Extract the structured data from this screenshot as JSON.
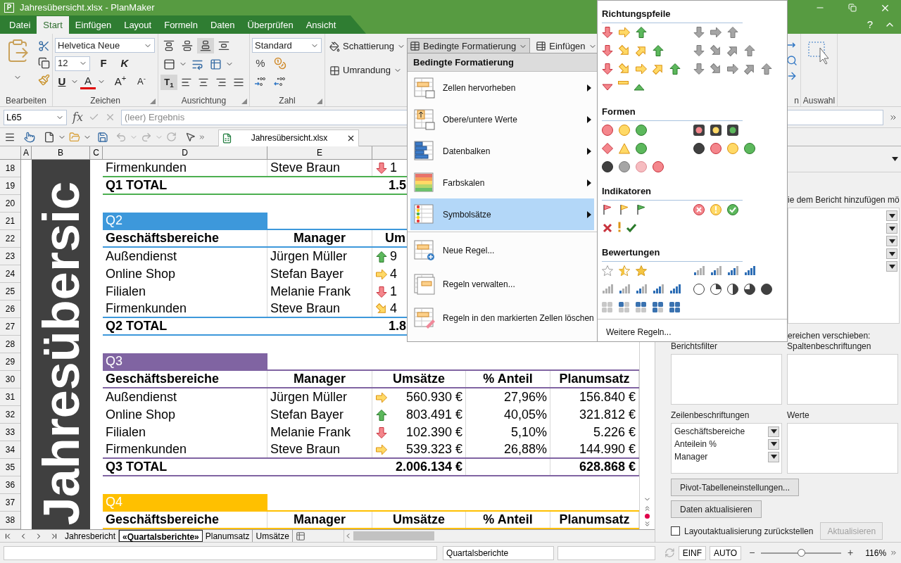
{
  "window": {
    "icon_letter": "P",
    "title": "Jahresübersicht.xlsx - PlanMaker",
    "help": "?"
  },
  "menu_tabs": [
    {
      "label": "Datei",
      "selected": false
    },
    {
      "label": "Start",
      "selected": true
    },
    {
      "label": "Einfügen",
      "selected": false
    },
    {
      "label": "Layout",
      "selected": false
    },
    {
      "label": "Formeln",
      "selected": false
    },
    {
      "label": "Daten",
      "selected": false
    },
    {
      "label": "Überprüfen",
      "selected": false
    },
    {
      "label": "Ansicht",
      "selected": false
    }
  ],
  "ribbon": {
    "font": "Helvetica Neue",
    "size": "12",
    "bold": "F",
    "italic": "K",
    "underline": "U",
    "font_color": "A",
    "grow": "A$^{+}$",
    "shrink": "A$^{-}$",
    "valign": [
      {
        "selected": false
      },
      {
        "selected": false
      },
      {
        "selected": true
      },
      {
        "selected": false
      }
    ],
    "rotate_text": {
      "label": "T$_{1}$",
      "selected": true
    },
    "number_format": "Standard",
    "percent": "%",
    "format_buttons": [
      {
        "label": "Schattierung",
        "open": false
      },
      {
        "label": "Umrandung",
        "open": false
      },
      {
        "label": "Bedingte Formatierung",
        "open": true
      },
      {
        "label": "Einfügen",
        "open": false
      }
    ],
    "groups": [
      {
        "label": "Bearbeiten",
        "launcher": false
      },
      {
        "label": "Zeichen",
        "launcher": true
      },
      {
        "label": "Ausrichtung",
        "launcher": true
      },
      {
        "label": "Zahl",
        "launcher": true
      },
      {
        "label": "n"
      },
      {
        "label": "Auswahl",
        "launcher": false
      }
    ]
  },
  "formula_bar": {
    "cell_ref": "L65",
    "function": "fx",
    "placeholder": "(leer) Ergebnis"
  },
  "toolbar": {
    "document_tab": "Jahresübersicht.xlsx"
  },
  "sheet": {
    "columns": [
      "A",
      "B",
      "C",
      "D",
      "E"
    ],
    "vertical_title": "Jahresübersic",
    "sections": [
      {
        "color": "#4caf50",
        "rows": [
          {
            "num": "18",
            "kind": "data",
            "name": "Firmenkunden",
            "manager": "Steve Braun",
            "trend": {
              "kind": "down"
            },
            "sales": "1"
          },
          {
            "num": "19",
            "kind": "total",
            "label": "Q1 TOTAL",
            "sales": "1.5"
          },
          {
            "num": "20",
            "kind": "empty"
          }
        ]
      },
      {
        "color": "#3d98db",
        "rows": [
          {
            "num": "21",
            "kind": "section",
            "label": "Q2"
          },
          {
            "num": "22",
            "kind": "header",
            "cells": [
              "Geschäftsbereiche",
              "Manager",
              "Um"
            ]
          },
          {
            "num": "23",
            "kind": "data",
            "name": "Außendienst",
            "manager": "Jürgen Müller",
            "trend": {
              "kind": "up"
            },
            "sales": "9"
          },
          {
            "num": "24",
            "kind": "data",
            "name": "Online Shop",
            "manager": "Stefan Bayer",
            "trend": {
              "kind": "right"
            },
            "sales": "4"
          },
          {
            "num": "25",
            "kind": "data",
            "name": "Filialen",
            "manager": "Melanie Frank",
            "trend": {
              "kind": "down"
            },
            "sales": "1"
          },
          {
            "num": "26",
            "kind": "data",
            "name": "Firmenkunden",
            "manager": "Steve Braun",
            "trend": {
              "kind": "down_right"
            },
            "sales": "4"
          },
          {
            "num": "27",
            "kind": "total",
            "label": "Q2 TOTAL",
            "sales": "1.8"
          },
          {
            "num": "28",
            "kind": "empty"
          }
        ]
      },
      {
        "color": "#8064a2",
        "rows": [
          {
            "num": "29",
            "kind": "section",
            "label": "Q3"
          },
          {
            "num": "30",
            "kind": "header",
            "cells": [
              "Geschäftsbereiche",
              "Manager",
              "Umsätze",
              "% Anteil",
              "Planumsatz"
            ]
          },
          {
            "num": "31",
            "kind": "data",
            "name": "Außendienst",
            "manager": "Jürgen Müller",
            "trend": {
              "kind": "right"
            },
            "sales": "560.930 €",
            "share": "27,96%",
            "plan": "156.840 €"
          },
          {
            "num": "32",
            "kind": "data",
            "name": "Online Shop",
            "manager": "Stefan Bayer",
            "trend": {
              "kind": "up"
            },
            "sales": "803.491 €",
            "share": "40,05%",
            "plan": "321.812 €"
          },
          {
            "num": "33",
            "kind": "data",
            "name": "Filialen",
            "manager": "Melanie Frank",
            "trend": {
              "kind": "down"
            },
            "sales": "102.390 €",
            "share": "5,10%",
            "plan": "5.226 €"
          },
          {
            "num": "34",
            "kind": "data",
            "name": "Firmenkunden",
            "manager": "Steve Braun",
            "trend": {
              "kind": "right"
            },
            "sales": "539.323 €",
            "share": "26,88%",
            "plan": "144.990 €"
          },
          {
            "num": "35",
            "kind": "total",
            "label": "Q3 TOTAL",
            "sales": "2.006.134 €",
            "plan": "628.868 €"
          },
          {
            "num": "36",
            "kind": "empty"
          }
        ]
      },
      {
        "color": "#ffc000",
        "rows": [
          {
            "num": "37",
            "kind": "section",
            "label": "Q4"
          },
          {
            "num": "38",
            "kind": "header",
            "cells": [
              "Geschäftsbereiche",
              "Manager",
              "Umsätze",
              "% Anteil",
              "Planumsatz"
            ]
          }
        ]
      }
    ]
  },
  "sheet_tabs": [
    {
      "label": "Jahresbericht",
      "selected": false
    },
    {
      "label": "«Quartalsberichte»",
      "selected": true
    },
    {
      "label": "Planumsatz",
      "selected": false
    },
    {
      "label": "Umsätze",
      "selected": false
    }
  ],
  "status": {
    "sheet_name": "Quartalsberichte",
    "insert_mode": "EINF",
    "calc_mode": "AUTO",
    "zoom_out": "−",
    "zoom_in": "+",
    "zoom": {
      "level": 0.5
    },
    "zoom_label": "116%"
  },
  "panel": {
    "hint_fragment": "ie dem Bericht hinzufügen mö",
    "move_hint_fragment": "ereichen verschieben:",
    "areas": [
      {
        "label": "Berichtsfilter"
      },
      {
        "label": "Spaltenbeschriftungen"
      },
      {
        "label": "Zeilenbeschriftungen",
        "items": [
          "Geschäftsbereiche",
          "Anteilein %",
          "Manager"
        ]
      },
      {
        "label": "Werte"
      }
    ],
    "buttons": [
      "Pivot-Tabelleneinstellungen...",
      "Daten aktualisieren"
    ],
    "defer": {
      "label": "Layoutaktualisierung zurückstellen",
      "checked": false
    },
    "update": {
      "label": "Aktualisieren",
      "disabled": true
    }
  },
  "menu": {
    "title": "Bedingte Formatierung",
    "items": [
      {
        "label": "Zellen hervorheben",
        "kind": "highlight",
        "submenu": true,
        "selected": false
      },
      {
        "label": "Obere/untere Werte",
        "kind": "topbottom",
        "submenu": true,
        "selected": false
      },
      {
        "label": "Datenbalken",
        "kind": "databars",
        "submenu": true,
        "selected": false
      },
      {
        "label": "Farbskalen",
        "kind": "colorscales",
        "submenu": true,
        "selected": false
      },
      {
        "label": "Symbolsätze",
        "kind": "iconsets",
        "submenu": true,
        "selected": true
      },
      {
        "label": "Neue Regel...",
        "kind": "new",
        "submenu": false,
        "selected": false
      },
      {
        "label": "Regeln verwalten...",
        "kind": "manage",
        "submenu": false,
        "selected": false
      },
      {
        "label": "Regeln in den markierten Zellen löschen",
        "kind": "clear",
        "submenu": false,
        "selected": false
      }
    ]
  },
  "gallery": {
    "sections": [
      {
        "title": "Richtungspfeile",
        "kind": "arrows"
      },
      {
        "title": "Formen",
        "kind": "shapes"
      },
      {
        "title": "Indikatoren",
        "kind": "indicators"
      },
      {
        "title": "Bewertungen",
        "kind": "ratings"
      }
    ],
    "more": "Weitere Regeln..."
  }
}
